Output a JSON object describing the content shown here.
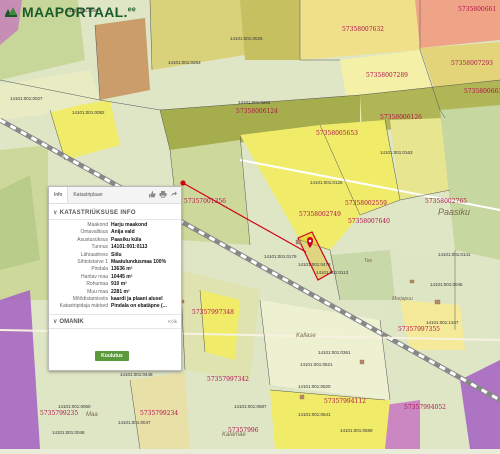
{
  "logo": {
    "name": "MAAPORTAAL",
    "suffix": "ee"
  },
  "map": {
    "cadastral_ids": [
      "57358007632",
      "57358007289",
      "57358007293",
      "5735800661",
      "5735800663",
      "57358006126",
      "57358006124",
      "57358005653",
      "57358002559",
      "57358002765",
      "57358002749",
      "57358007640",
      "57357001356",
      "57357997348",
      "57357997355",
      "57357997342",
      "5735799235",
      "5735799234",
      "57357994052",
      "57357994112",
      "57357996"
    ],
    "grid_ids": [
      "14101:001:0065",
      "14101:001:0263",
      "14101:001:0026",
      "14101:001:0027",
      "14101:001:0082",
      "14101:001:0264",
      "14101:001:0128",
      "14101:001:0163",
      "14101:001:0179",
      "14101:001:0141",
      "14101:001:0045",
      "14101:001:0478",
      "14101:001:0113",
      "14101:001:1347",
      "14101:001:0361",
      "14101:001:0448",
      "14101:001:0520",
      "14101:001:0521",
      "14101:001:0587",
      "14101:001:0541",
      "14101:001:0589",
      "14101:001:0050",
      "14101:001:0048",
      "14101:001:0047"
    ],
    "places": {
      "paasiku": "Paasiku",
      "kallase": "Kallase",
      "maa": "Maa",
      "marjapuu": "Marjapuu",
      "kandimae": "Kalamäe",
      "tee": "Tee"
    }
  },
  "panel": {
    "tabs": [
      "Info",
      "Katastriplaan"
    ],
    "section_title": "KATASTRIÜKSUSE INFO",
    "rows": [
      {
        "k": "Maakond",
        "v": "Harju maakond"
      },
      {
        "k": "Omavalitsus",
        "v": "Anija vald"
      },
      {
        "k": "Asustusüksus",
        "v": "Paasiku küla"
      },
      {
        "k": "Tunnus",
        "v": "14101:001:0113"
      },
      {
        "k": "Lähiaadress",
        "v": "Siilu"
      },
      {
        "k": "Sihtotstarve 1",
        "v": "Maatulundusmaa 100%"
      },
      {
        "k": "Pindala",
        "v": "13636 m²"
      },
      {
        "k": "Haritav maa",
        "v": "10445 m²"
      },
      {
        "k": "Rohumaa",
        "v": "910 m²"
      },
      {
        "k": "Muu maa",
        "v": "2281 m²"
      },
      {
        "k": "Mõõdistamisviis",
        "v": "kaardi ja plaani alusel"
      },
      {
        "k": "Katastripidaja märked",
        "v": "Pindala on ebatäpne (..."
      }
    ],
    "owner_title": "OMANIK",
    "owner_all": "Kõik",
    "button_label": "Kuulutus"
  },
  "colors": {
    "parcel_yellow": "#f0ec6a",
    "field_green": "#cdd99a",
    "forest_green": "#b9cc8a",
    "olive": "#a6ad4c",
    "purple_zone": "#a35fc2",
    "salmon": "#f0a487",
    "brown": "#c9955f",
    "button_green": "#5a9a3a",
    "label_magenta": "#b0124a",
    "selection_red": "#d0021b"
  }
}
